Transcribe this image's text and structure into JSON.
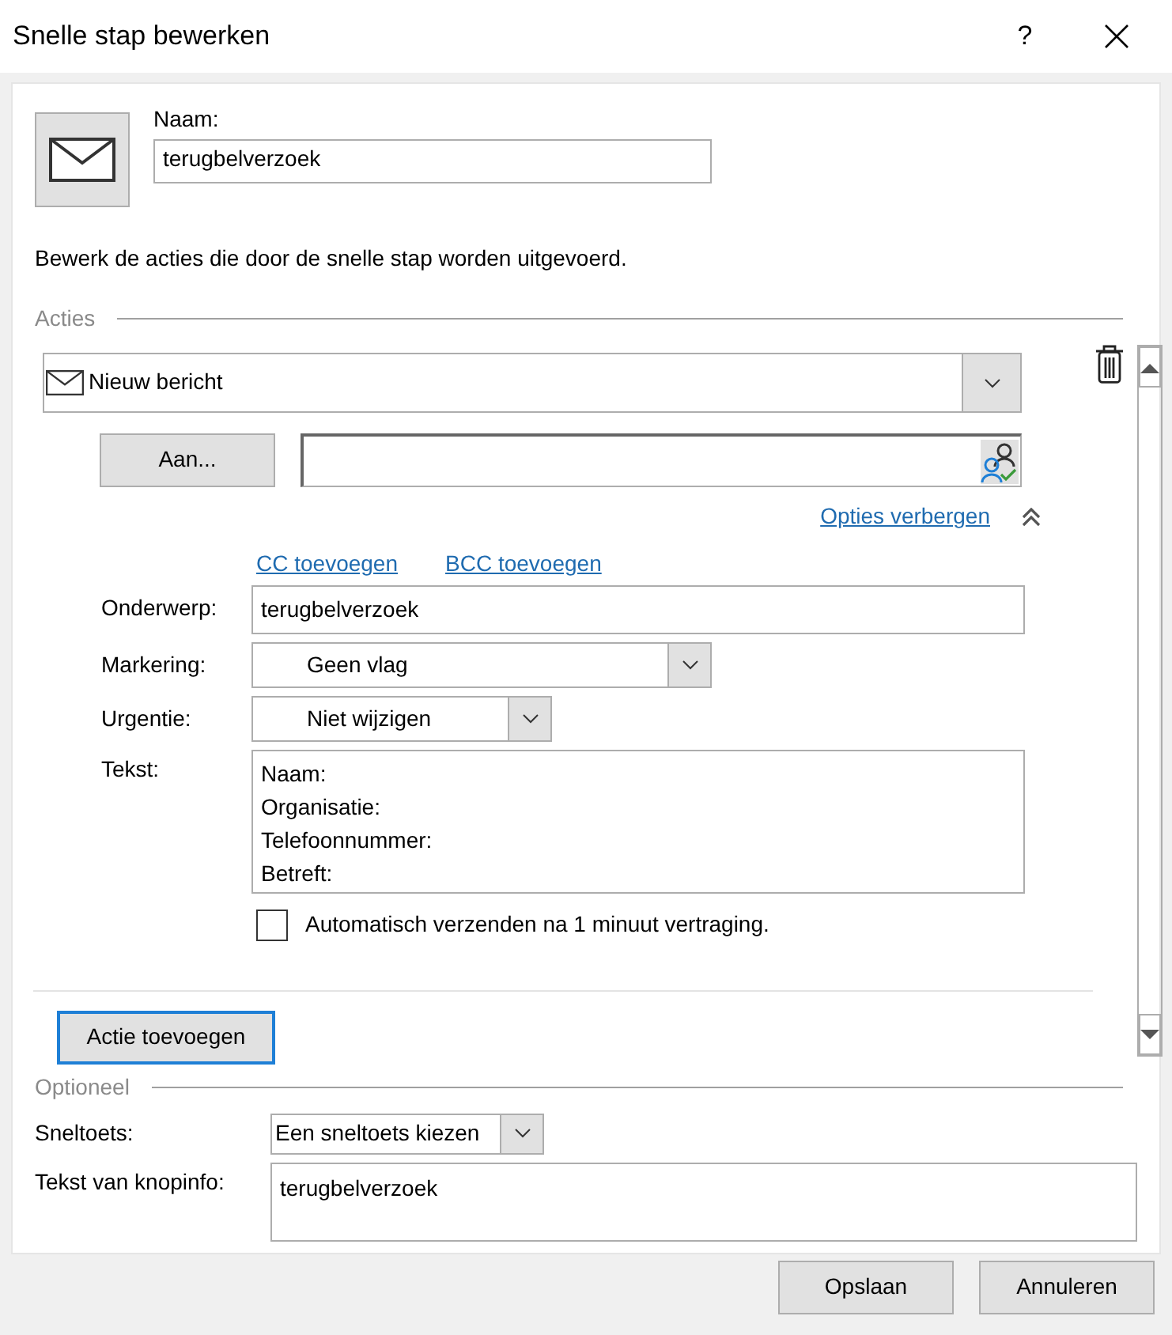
{
  "window": {
    "title": "Snelle stap bewerken",
    "help": "?"
  },
  "name_field": {
    "label": "Naam:",
    "value": "terugbelverzoek"
  },
  "description": "Bewerk de acties die door de snelle stap worden uitgevoerd.",
  "actions_section": {
    "heading": "Acties",
    "action": {
      "type": "Nieuw bericht",
      "to_button": "Aan...",
      "options_link": "Opties verbergen",
      "cc_link": "CC toevoegen",
      "bcc_link": "BCC toevoegen",
      "fields": [
        {
          "kind": "text",
          "label": "Onderwerp:",
          "value": "terugbelverzoek"
        },
        {
          "kind": "select",
          "label": "Markering:",
          "value": "Geen vlag"
        },
        {
          "kind": "select",
          "label": "Urgentie:",
          "value": "Niet wijzigen"
        },
        {
          "kind": "textarea",
          "label": "Tekst:",
          "value": "Naam:\nOrganisatie:\nTelefoonnummer:\nBetreft:"
        }
      ],
      "auto_send": {
        "label": "Automatisch verzenden na 1 minuut vertraging.",
        "checked": false
      }
    },
    "add_button": "Actie toevoegen"
  },
  "optional_section": {
    "heading": "Optioneel",
    "shortcut": {
      "label": "Sneltoets:",
      "value": "Een sneltoets kiezen"
    },
    "tooltip": {
      "label": "Tekst van knopinfo:",
      "value": "terugbelverzoek"
    }
  },
  "buttons": [
    {
      "label": "Opslaan"
    },
    {
      "label": "Annuleren"
    }
  ]
}
